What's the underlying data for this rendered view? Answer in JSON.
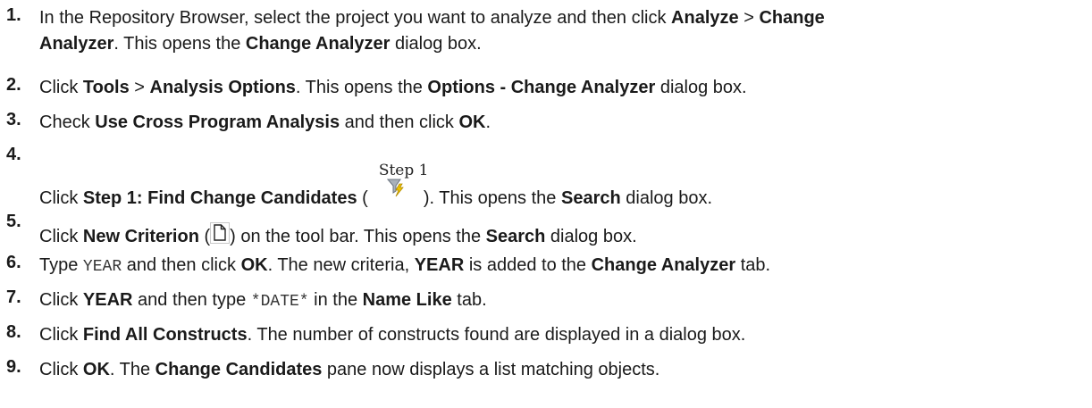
{
  "steps": [
    {
      "num": "1.",
      "line1": {
        "t1": "In the Repository Browser, select the project you want to analyze and then click ",
        "b1": "Analyze",
        "t2": " > ",
        "b2": "Change"
      },
      "line2": {
        "b1": "Analyzer",
        "t1": ". This opens the ",
        "b2": "Change Analyzer",
        "t2": " dialog box."
      }
    },
    {
      "num": "2.",
      "t1": "Click ",
      "b1": "Tools",
      "t2": " > ",
      "b2": "Analysis Options",
      "t3": ". This opens the ",
      "b3": "Options - Change Analyzer",
      "t4": " dialog box."
    },
    {
      "num": "3.",
      "t1": "Check ",
      "b1": "Use Cross Program Analysis",
      "t2": " and then click ",
      "b2": "OK",
      "t3": "."
    },
    {
      "num": "4.",
      "t1": "Click ",
      "b1": "Step 1: Find Change Candidates",
      "t2": " (",
      "icon_label": "Step 1",
      "icon": "filter-lightning-icon",
      "t3": "). This opens the ",
      "b2": "Search",
      "t4": " dialog box."
    },
    {
      "num": "5.",
      "t1": "Click ",
      "b1": "New Criterion",
      "t2": " (",
      "icon": "new-document-icon",
      "t3": ") on the tool bar. This opens the ",
      "b2": "Search",
      "t4": " dialog box."
    },
    {
      "num": "6.",
      "t1": "Type ",
      "c1": "YEAR",
      "t2": " and then click ",
      "b1": "OK",
      "t3": ". The new criteria, ",
      "b2": "YEAR",
      "t4": " is added to the ",
      "b3": "Change Analyzer",
      "t5": " tab."
    },
    {
      "num": "7.",
      "t1": "Click ",
      "b1": "YEAR",
      "t2": " and then type ",
      "c1": "*DATE*",
      "t3": " in the ",
      "b2": "Name Like",
      "t4": " tab."
    },
    {
      "num": "8.",
      "t1": "Click ",
      "b1": "Find All Constructs",
      "t2": ". The number of constructs found are displayed in a dialog box."
    },
    {
      "num": "9.",
      "t1": "Click ",
      "b1": "OK",
      "t2": ". The ",
      "b2": "Change Candidates",
      "t3": " pane now displays a list matching objects."
    }
  ],
  "colors": {
    "text": "#1a1a1a",
    "icon_filter": "#7a8490",
    "icon_bolt": "#e8b800"
  }
}
